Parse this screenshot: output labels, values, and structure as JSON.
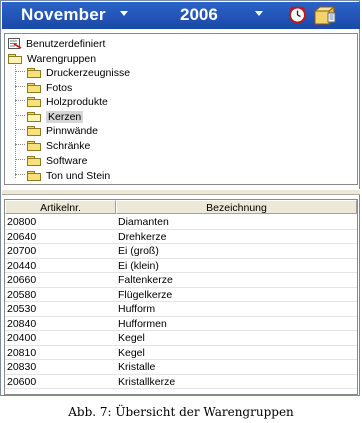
{
  "header": {
    "month": "November",
    "year": "2006",
    "icons": {
      "clock": "alarm-clock-icon",
      "box": "box-export-icon"
    },
    "colors": {
      "bar": "#1f4fb0",
      "text": "#ffffff"
    }
  },
  "tree": {
    "root_items": [
      {
        "label": "Benutzerdefiniert",
        "icon": "custom-list-icon"
      },
      {
        "label": "Warengruppen",
        "icon": "folder-icon"
      }
    ],
    "children": [
      {
        "label": "Druckerzeugnisse",
        "selected": false
      },
      {
        "label": "Fotos",
        "selected": false
      },
      {
        "label": "Holzprodukte",
        "selected": false
      },
      {
        "label": "Kerzen",
        "selected": true
      },
      {
        "label": "Pinnwände",
        "selected": false
      },
      {
        "label": "Schränke",
        "selected": false
      },
      {
        "label": "Software",
        "selected": false
      },
      {
        "label": "Ton und Stein",
        "selected": false
      }
    ]
  },
  "table": {
    "columns": [
      "Artikelnr.",
      "Bezeichnung"
    ],
    "rows": [
      [
        "20800",
        "Diamanten"
      ],
      [
        "20640",
        "Drehkerze"
      ],
      [
        "20700",
        "Ei (groß)"
      ],
      [
        "20440",
        "Ei (klein)"
      ],
      [
        "20660",
        "Faltenkerze"
      ],
      [
        "20580",
        "Flügelkerze"
      ],
      [
        "20530",
        "Hufform"
      ],
      [
        "20840",
        "Hufformen"
      ],
      [
        "20400",
        "Kegel"
      ],
      [
        "20810",
        "Kegel"
      ],
      [
        "20830",
        "Kristalle"
      ],
      [
        "20600",
        "Kristallkerze"
      ]
    ]
  },
  "caption": "Abb. 7: Übersicht der Warengruppen"
}
